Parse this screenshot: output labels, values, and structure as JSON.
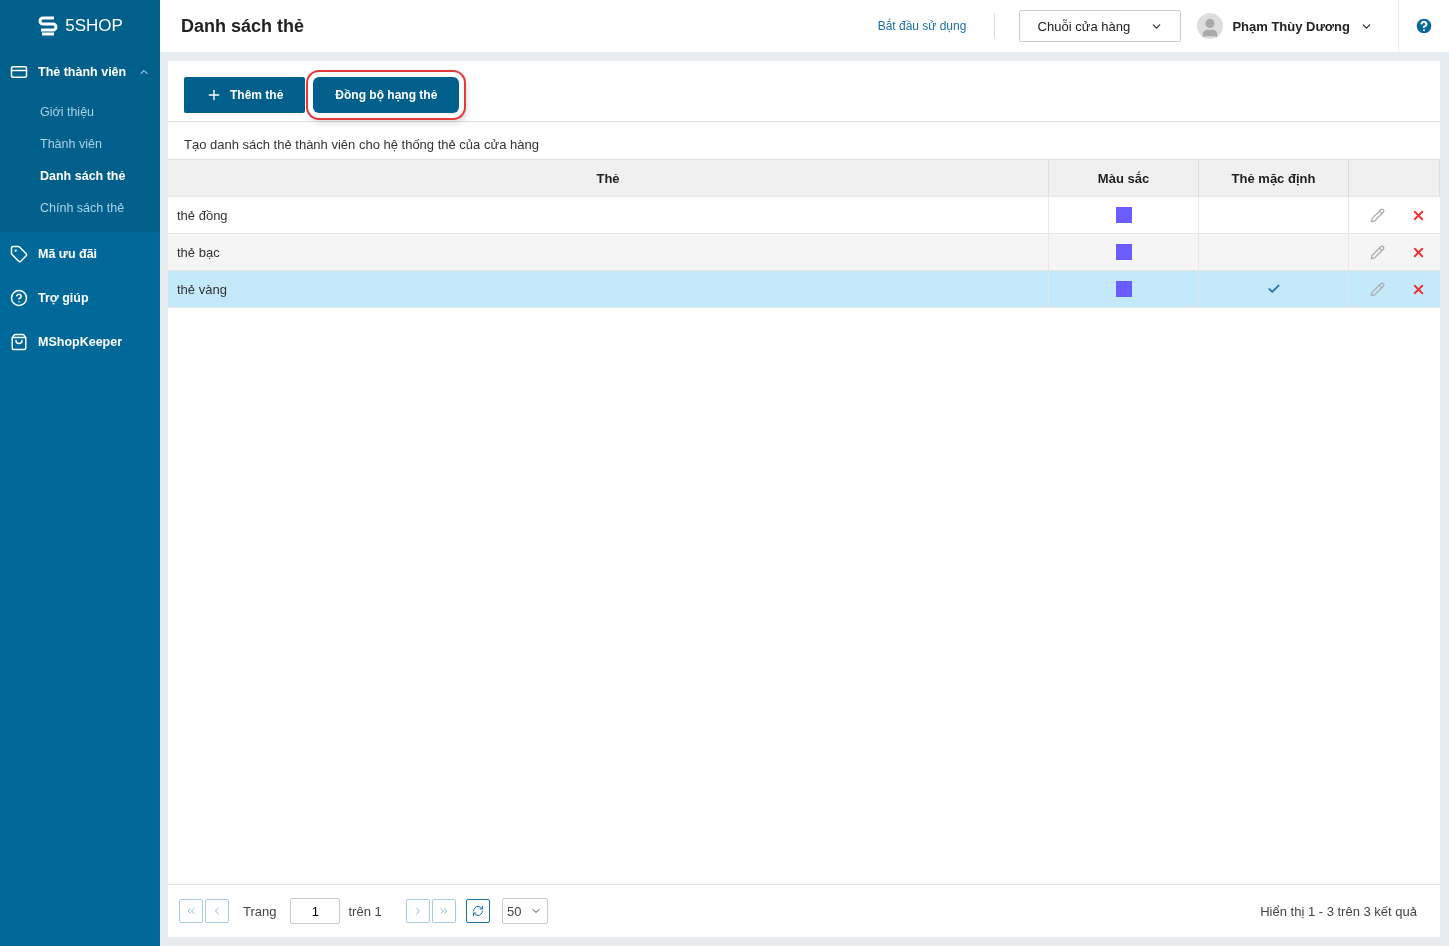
{
  "sidebar": {
    "logo": "5SHOP",
    "items": [
      {
        "label": "Thẻ thành viên",
        "expanded": true,
        "children": [
          {
            "label": "Giới thiệu",
            "selected": false
          },
          {
            "label": "Thành viên",
            "selected": false
          },
          {
            "label": "Danh sách thẻ",
            "selected": true
          },
          {
            "label": "Chính sách thẻ",
            "selected": false
          }
        ]
      },
      {
        "label": "Mã ưu đãi",
        "expanded": false
      },
      {
        "label": "Trợ giúp",
        "expanded": false
      },
      {
        "label": "MShopKeeper",
        "expanded": false
      }
    ]
  },
  "header": {
    "title": "Danh sách thẻ",
    "link": "Bắt đầu sử dụng",
    "store_select": "Chuỗi cửa hàng",
    "user": "Phạm Thùy Dương"
  },
  "toolbar": {
    "buttons": [
      {
        "label": "Thêm thẻ",
        "kind": "add",
        "highlighted": false
      },
      {
        "label": "Đồng bộ hạng thẻ",
        "kind": "plain",
        "highlighted": true
      }
    ]
  },
  "description": "Tạo danh sách thẻ thành viên cho hệ thống thẻ của cửa hàng",
  "table": {
    "columns": [
      "Thẻ",
      "Màu sắc",
      "Thẻ mặc định"
    ],
    "rows": [
      {
        "name": "thẻ đồng",
        "color": "#6a5cff",
        "default": false,
        "selected": false
      },
      {
        "name": "thẻ bạc",
        "color": "#6a5cff",
        "default": false,
        "selected": false
      },
      {
        "name": "thẻ vàng",
        "color": "#6a5cff",
        "default": true,
        "selected": true
      }
    ]
  },
  "pager": {
    "page_label": "Trang",
    "page": "1",
    "of": "trên 1",
    "page_size": "50",
    "summary": "Hiển thị 1 - 3 trên 3 kết quả"
  }
}
